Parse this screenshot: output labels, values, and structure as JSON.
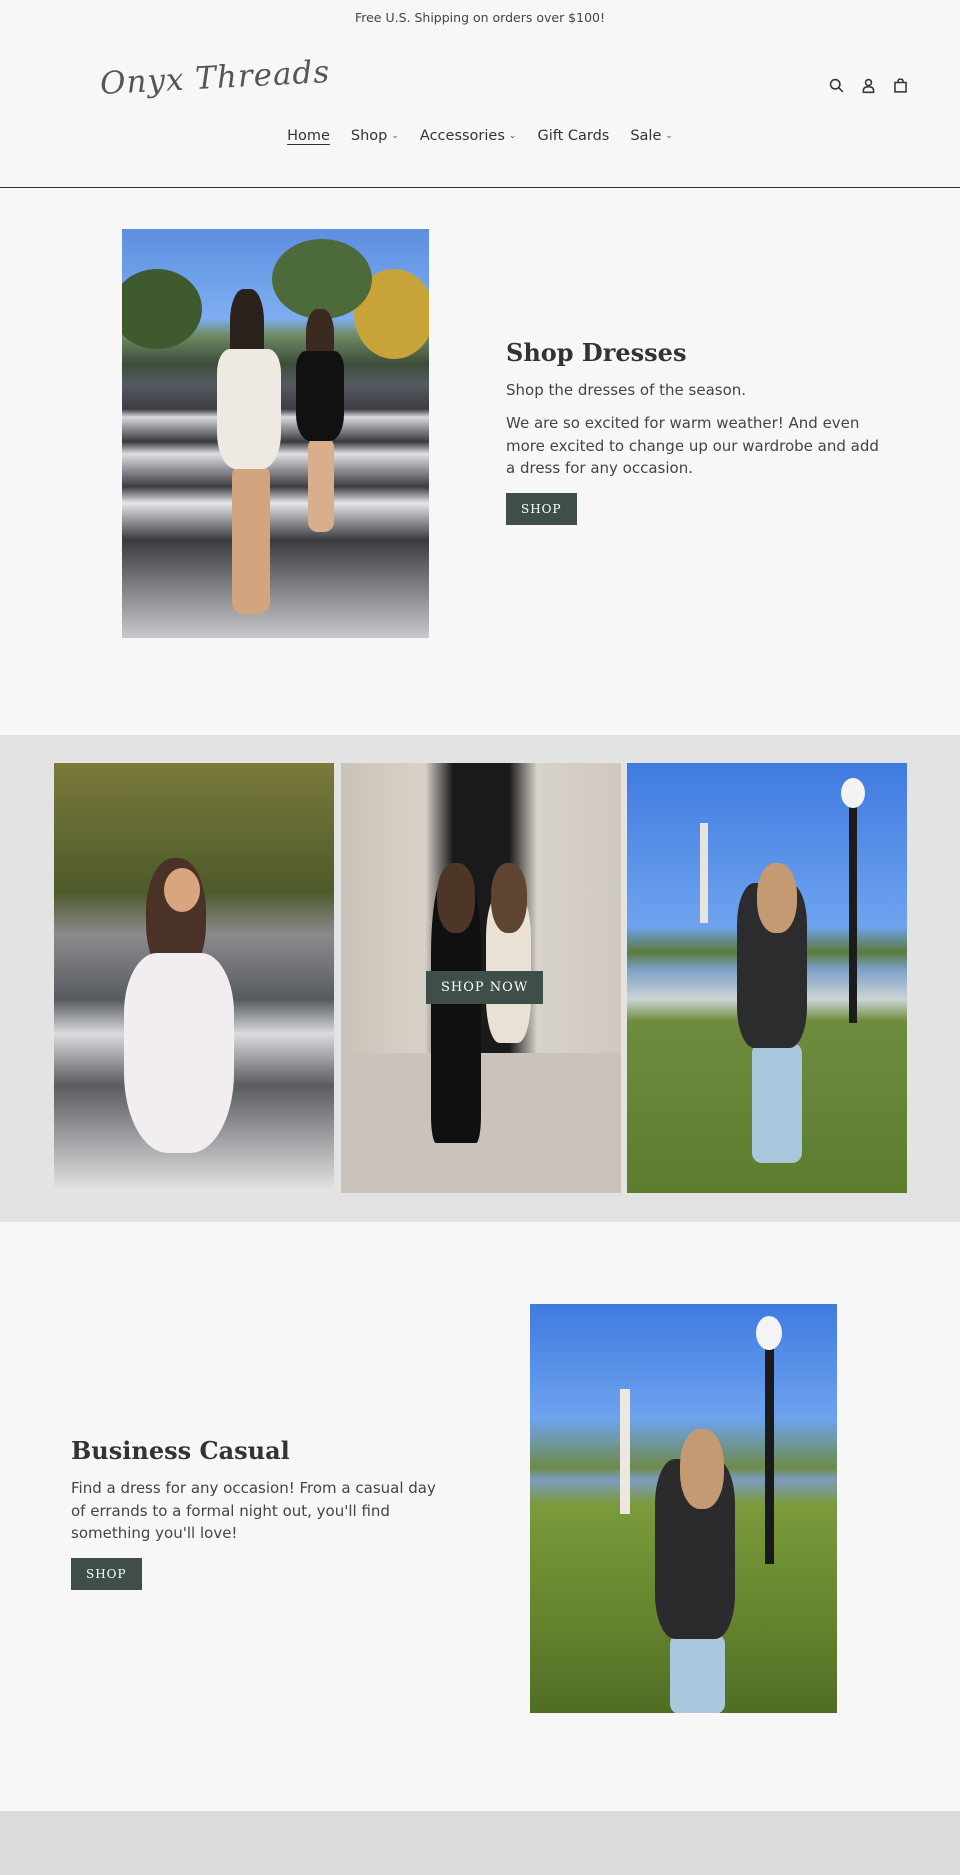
{
  "announcement": {
    "text": "Free U.S. Shipping on orders over $100!"
  },
  "header": {
    "logo": "Onyx Threads",
    "icons": [
      "search-icon",
      "account-icon",
      "cart-icon"
    ]
  },
  "nav": {
    "items": [
      {
        "label": "Home",
        "has_dropdown": false,
        "active": true
      },
      {
        "label": "Shop",
        "has_dropdown": true
      },
      {
        "label": "Accessories",
        "has_dropdown": true
      },
      {
        "label": "Gift Cards",
        "has_dropdown": false
      },
      {
        "label": "Sale",
        "has_dropdown": true
      }
    ],
    "chevron": "⌄"
  },
  "hero": {
    "title": "Shop Dresses",
    "subtitle": "Shop the dresses of the season.",
    "body": "We are so excited for warm weather! And even more excited to change up our wardrobe and add a dress for any occasion.",
    "button": "SHOP"
  },
  "gallery": {
    "button": "SHOP NOW"
  },
  "business": {
    "title": "Business Casual",
    "body": "Find a dress for any occasion! From a casual day of errands to a formal night out, you'll find something you'll love!",
    "button": "SHOP"
  },
  "colors": {
    "button_bg": "#3f4e49",
    "page_bg": "#f7f7f7",
    "gallery_bg": "#e3e3e3",
    "footer_bg": "#dcdcdc"
  }
}
